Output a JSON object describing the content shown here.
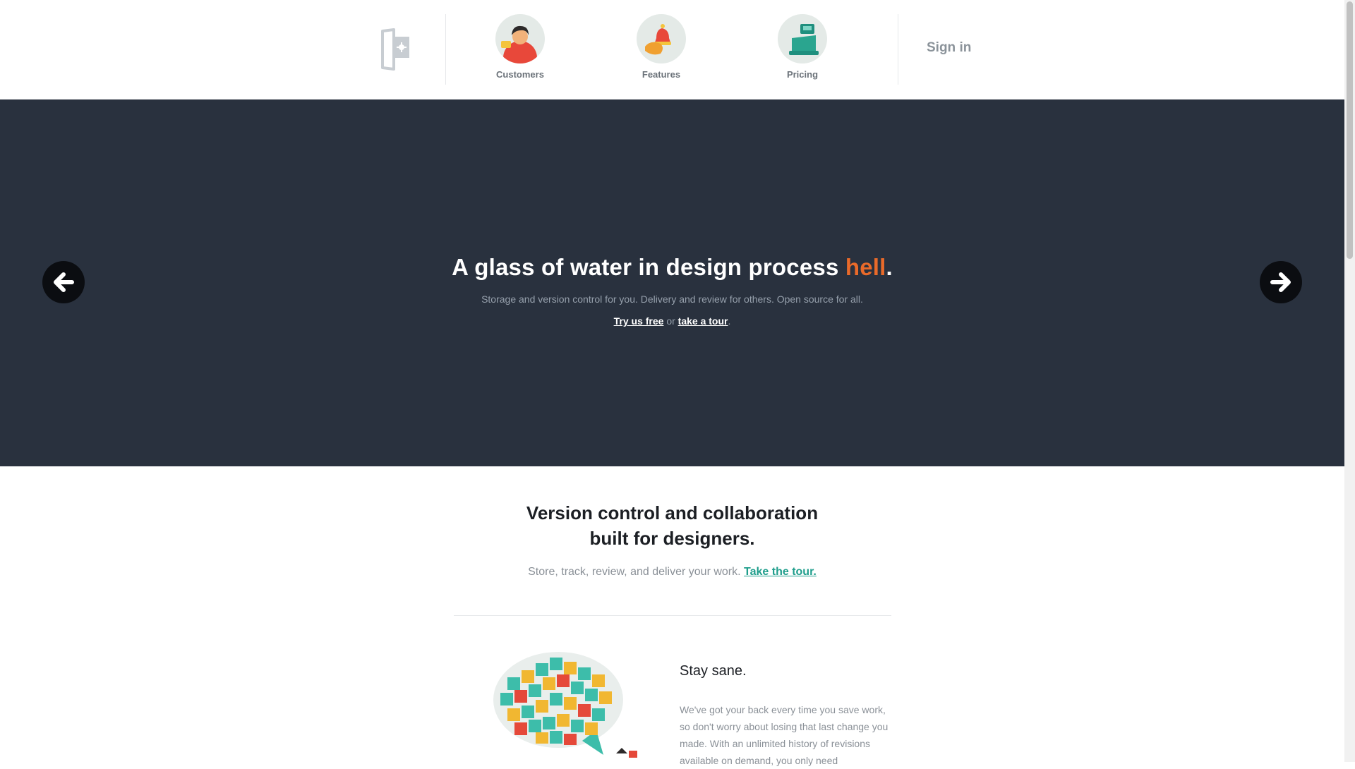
{
  "nav": {
    "items": [
      {
        "label": "Customers",
        "icon": "customer-avatar-icon"
      },
      {
        "label": "Features",
        "icon": "bell-icon"
      },
      {
        "label": "Pricing",
        "icon": "cash-register-icon"
      }
    ],
    "signin_label": "Sign in"
  },
  "hero": {
    "title_main": "A glass of water in design process ",
    "title_accent": "hell",
    "title_end": ".",
    "subtitle": "Storage and version control for you. Delivery and review for others. Open source for all.",
    "link_try": "Try us free",
    "link_or": " or ",
    "link_tour": "take a tour",
    "link_end": "."
  },
  "section": {
    "title_line1": "Version control and collaboration",
    "title_line2": "built for designers.",
    "subtitle": "Store, track, review, and deliver your work. ",
    "tour_link": "Take the tour."
  },
  "feature": {
    "title": "Stay sane.",
    "text": "We've got your back every time you save work, so don't worry about losing that last change you made. With an unlimited history of revisions available on demand, you only need"
  },
  "colors": {
    "hero_bg": "#29313e",
    "accent": "#e96a2a",
    "link_teal": "#1f9e8c"
  }
}
